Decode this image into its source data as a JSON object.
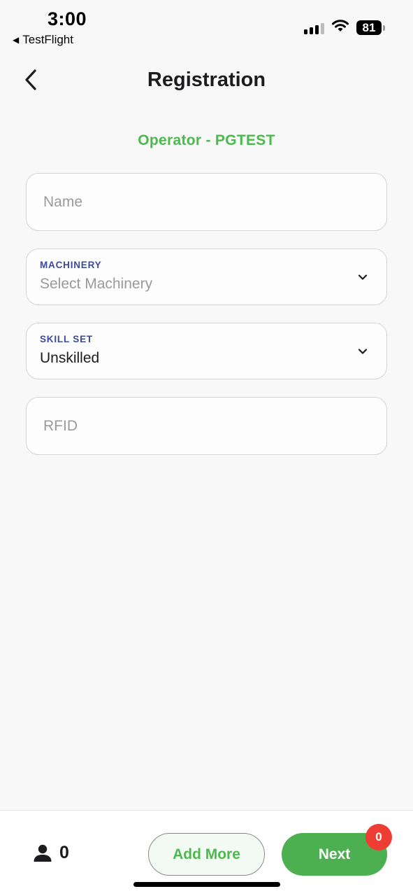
{
  "status_bar": {
    "time": "3:00",
    "back_app": "TestFlight",
    "back_icon": "triangle-left-icon",
    "signal_icon": "cellular-signal-icon",
    "wifi_icon": "wifi-icon",
    "battery_level": "81"
  },
  "header": {
    "title": "Registration",
    "back_icon": "chevron-left-icon"
  },
  "subtitle": "Operator - PGTEST",
  "form": {
    "name": {
      "placeholder": "Name",
      "value": ""
    },
    "machinery": {
      "label": "MACHINERY",
      "value": "Select Machinery",
      "is_placeholder": true
    },
    "skill_set": {
      "label": "SKILL SET",
      "value": "Unskilled",
      "is_placeholder": false
    },
    "rfid": {
      "placeholder": "RFID",
      "value": ""
    }
  },
  "bottom_bar": {
    "operator_count": "0",
    "person_icon": "person-icon",
    "add_more_label": "Add More",
    "next_label": "Next",
    "next_badge": "0"
  },
  "colors": {
    "accent_green": "#4cb94f",
    "button_green": "#4caf50",
    "label_blue": "#3b4a9a",
    "badge_red": "#ee3e33",
    "background": "#f8f8f8"
  }
}
